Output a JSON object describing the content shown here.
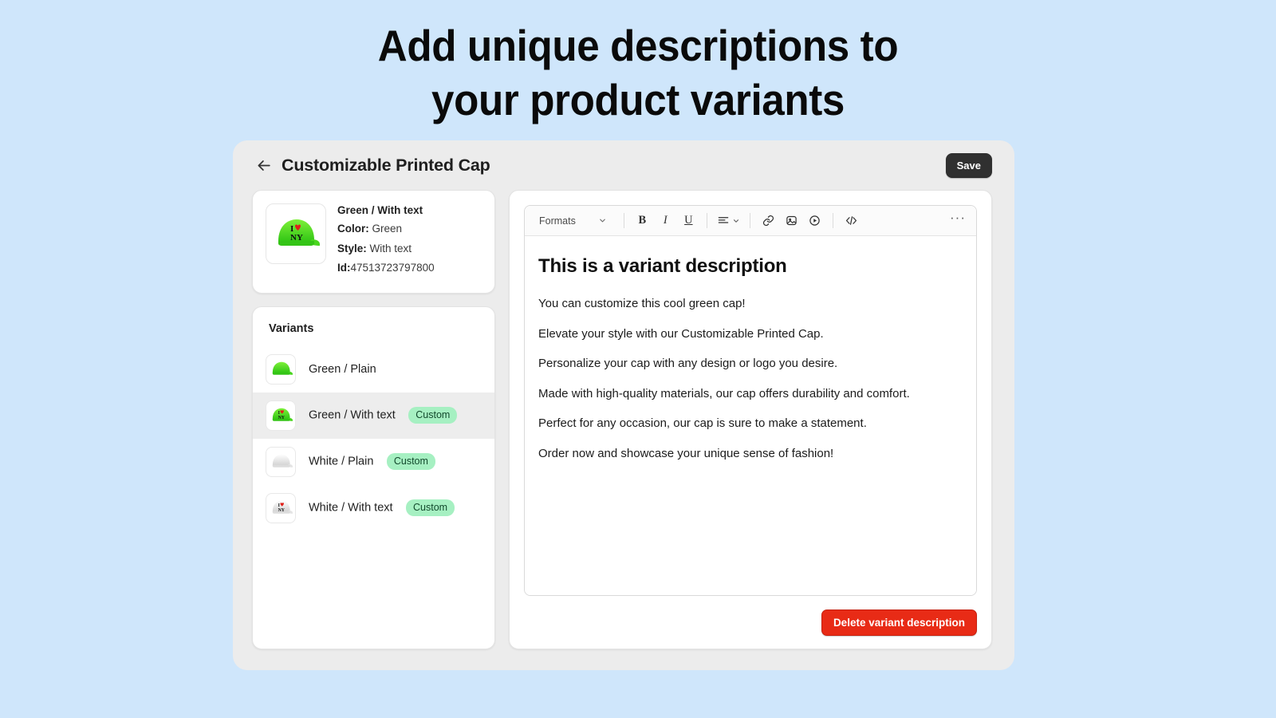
{
  "hero": {
    "line1": "Add unique descriptions to",
    "line2": "your product variants"
  },
  "app": {
    "back_icon": "arrow-left-icon",
    "title": "Customizable Printed Cap",
    "save_label": "Save"
  },
  "variant_info": {
    "image": "green-cap-with-text-thumbnail",
    "title": "Green / With text",
    "color_label": "Color:",
    "color_value": "Green",
    "style_label": "Style:",
    "style_value": "With text",
    "id_label": "Id:",
    "id_value": "47513723797800"
  },
  "variants_panel": {
    "heading": "Variants",
    "items": [
      {
        "label": "Green / Plain",
        "badge": "",
        "selected": false,
        "image": "green-cap-plain-thumbnail"
      },
      {
        "label": "Green / With text",
        "badge": "Custom",
        "selected": true,
        "image": "green-cap-with-text-thumbnail"
      },
      {
        "label": "White / Plain",
        "badge": "Custom",
        "selected": false,
        "image": "white-cap-plain-thumbnail"
      },
      {
        "label": "White / With text",
        "badge": "Custom",
        "selected": false,
        "image": "white-cap-with-text-thumbnail"
      }
    ]
  },
  "editor": {
    "toolbar": {
      "formats_label": "Formats",
      "bold_label": "B",
      "italic_label": "I",
      "underline_label": "U",
      "more_label": "···",
      "icons": [
        "chevron-down-icon",
        "bold-icon",
        "italic-icon",
        "underline-icon",
        "align-icon",
        "link-icon",
        "image-icon",
        "video-icon",
        "code-icon",
        "more-horizontal-icon"
      ]
    },
    "document": {
      "heading": "This is a variant description",
      "paragraphs": [
        "You can customize this cool green cap!",
        "Elevate your style with our Customizable Printed Cap.",
        "Personalize your cap with any design or logo you desire.",
        "Made with high-quality materials, our cap offers durability and comfort.",
        "Perfect for any occasion, our cap is sure to make a statement.",
        "Order now and showcase your unique sense of fashion!"
      ]
    },
    "delete_label": "Delete variant description"
  },
  "colors": {
    "page_background": "#cfe6fb",
    "window_background": "#ececec",
    "card_background": "#ffffff",
    "save_button": "#303030",
    "delete_button": "#e82b16",
    "badge_background": "#a6f0c2",
    "badge_text": "#12492c",
    "selected_row": "#ededed"
  }
}
